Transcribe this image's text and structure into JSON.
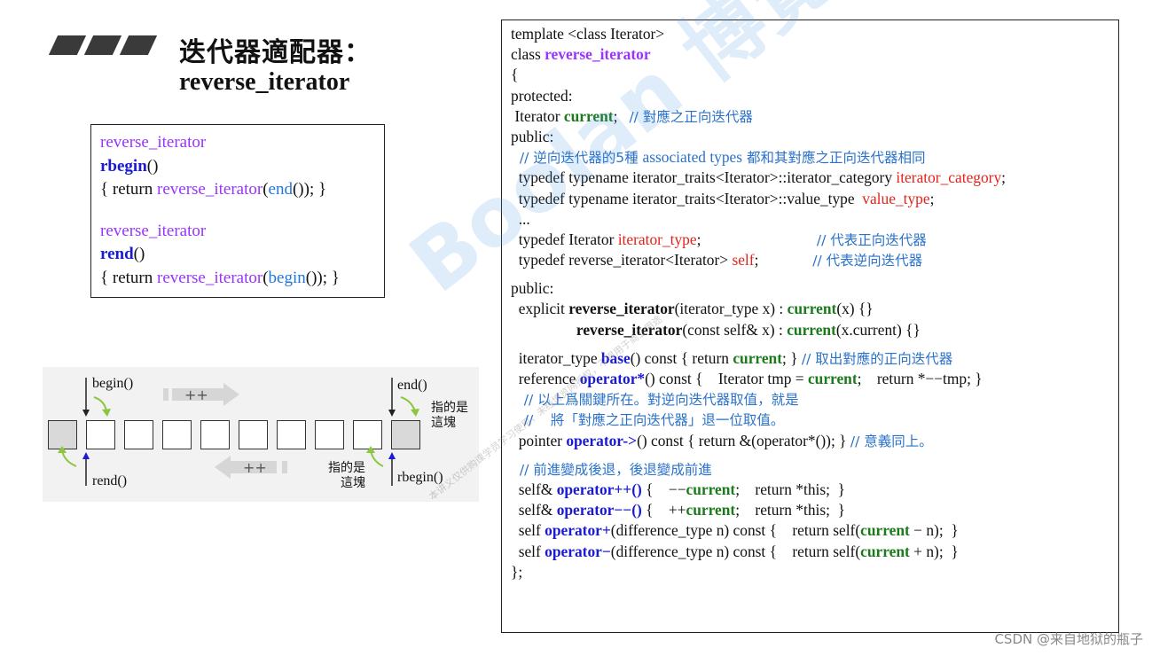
{
  "header": {
    "title_line1": "迭代器適配器：",
    "title_line2": "reverse_iterator"
  },
  "small_code": {
    "l1": "reverse_iterator",
    "l2_fn": "rbegin",
    "l2_rest": "()",
    "l3_a": "{ return ",
    "l3_b": "reverse_iterator",
    "l3_c": "(",
    "l3_d": "end",
    "l3_e": "()); }",
    "l4": "reverse_iterator",
    "l5_fn": "rend",
    "l5_rest": "()",
    "l6_a": "{ return ",
    "l6_b": "reverse_iterator",
    "l6_c": "(",
    "l6_d": "begin",
    "l6_e": "()); }"
  },
  "big_code": {
    "l01": "template <class Iterator>",
    "l02_a": "class ",
    "l02_b": "reverse_iterator",
    "l03": "{",
    "l04": "protected:",
    "l05_a": " Iterator ",
    "l05_b": "current",
    "l05_c": ";   ",
    "l05_d": "// 對應之正向迭代器",
    "l06": "public:",
    "l07_a": "  // 逆向迭代器的5種 ",
    "l07_b": "associated types",
    "l07_c": " 都和其對應之正向迭代器相同",
    "l08_a": "  typedef typename iterator_traits<Iterator>::iterator_category ",
    "l08_b": "iterator_category",
    "l08_c": ";",
    "l09_a": "  typedef typename iterator_traits<Iterator>::value_type  ",
    "l09_b": "value_type",
    "l09_c": ";",
    "l10": "  ...",
    "l11_a": "  typedef Iterator ",
    "l11_b": "iterator_type",
    "l11_c": ";                              ",
    "l11_d": "// 代表正向迭代器",
    "l12_a": "  typedef reverse_iterator<Iterator> ",
    "l12_b": "self",
    "l12_c": ";              ",
    "l12_d": "// 代表逆向迭代器",
    "l13": "public:",
    "l14_a": "  explicit ",
    "l14_b": "reverse_iterator",
    "l14_c": "(iterator_type x) : ",
    "l14_d": "current",
    "l14_e": "(x) {}",
    "l15_a": "                 ",
    "l15_b": "reverse_iterator",
    "l15_c": "(const self& x) : ",
    "l15_d": "current",
    "l15_e": "(x.current) {}",
    "l16_a": "  iterator_type ",
    "l16_b": "base",
    "l16_c": "() const { return ",
    "l16_d": "current",
    "l16_e": "; } ",
    "l16_f": "// 取出對應的正向迭代器",
    "l17_a": "  reference ",
    "l17_b": "operator*",
    "l17_c": "() const {    Iterator tmp = ",
    "l17_d": "current",
    "l17_e": ";    return *−−tmp; }",
    "l18": "   // 以上爲關鍵所在。對逆向迭代器取值，就是",
    "l19": "   //    將「對應之正向迭代器」退一位取值。",
    "l20_a": "  pointer ",
    "l20_b": "operator->",
    "l20_c": "() const { return &(operator*()); } ",
    "l20_d": "// 意義同上。",
    "l21": "  // 前進變成後退，後退變成前進",
    "l22_a": "  self& ",
    "l22_b": "operator++()",
    "l22_c": " {    −−",
    "l22_d": "current",
    "l22_e": ";    return *this;  }",
    "l23_a": "  self& ",
    "l23_b": "operator−−()",
    "l23_c": " {    ++",
    "l23_d": "current",
    "l23_e": ";    return *this;  }",
    "l24_a": "  self ",
    "l24_b": "operator+",
    "l24_c": "(difference_type n) const {    return self(",
    "l24_d": "current",
    "l24_e": " − n);  }",
    "l25_a": "  self ",
    "l25_b": "operator−",
    "l25_c": "(difference_type n) const {    return self(",
    "l25_d": "current",
    "l25_e": " + n);  }",
    "l26": "};"
  },
  "diagram": {
    "begin": "begin()",
    "end": "end()",
    "rend": "rend()",
    "rbegin": "rbegin()",
    "plus_top": "++",
    "plus_bottom": "++",
    "points_here_right_1": "指的是",
    "points_here_right_2": "這塊",
    "points_here_bottom_1": "指的是",
    "points_here_bottom_2": "這塊"
  },
  "watermark": {
    "big": "Boolan 博覽網",
    "small": "本讲义仅供购课学员学习使用，未经博览网授权，不得用于商业用途"
  },
  "credit": "CSDN @来自地狱的瓶子",
  "colors": {
    "purple": "#9933ff",
    "blue_bold": "#1a1ad6",
    "comment_blue": "#2a72c9",
    "green": "#1b7a1b",
    "red": "#e0241b"
  }
}
